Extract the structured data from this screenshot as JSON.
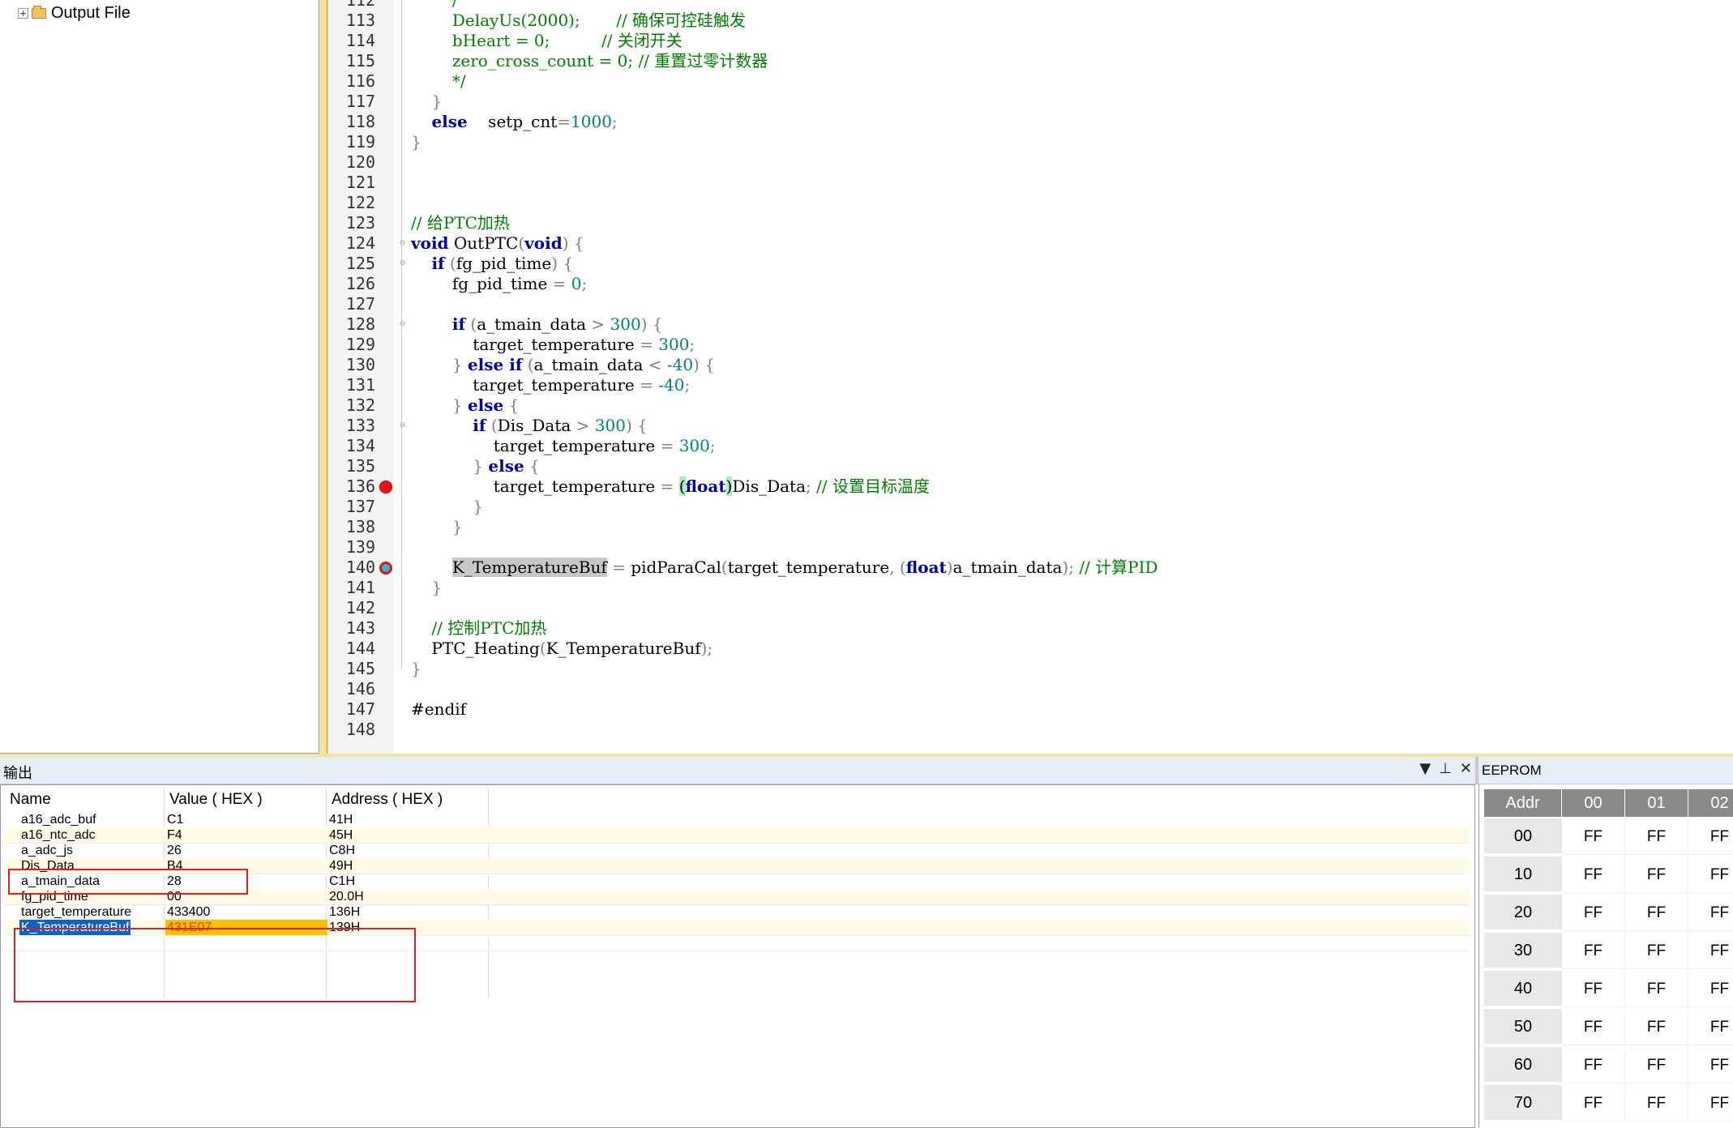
{
  "project_tree": {
    "output_file_label": "Output File"
  },
  "editor": {
    "lines": [
      {
        "n": "112",
        "html": "        <span class=\"cm\">/</span>"
      },
      {
        "n": "113",
        "html": "        <span class=\"cm\">DelayUs(2000);       // 确保可控硅触发</span>"
      },
      {
        "n": "114",
        "html": "        <span class=\"cm\">bHeart = 0;          // 关闭开关</span>"
      },
      {
        "n": "115",
        "html": "        <span class=\"cm\">zero_cross_count = 0; // 重置过零计数器</span>"
      },
      {
        "n": "116",
        "html": "        <span class=\"cm\">*/</span>"
      },
      {
        "n": "117",
        "html": "    <span class=\"pun\">}</span>"
      },
      {
        "n": "118",
        "html": "    <span class=\"kw\">else</span>    setp_cnt<span class=\"pun\">=</span><span class=\"num\">1000</span><span class=\"pun\">;</span>"
      },
      {
        "n": "119",
        "html": "<span class=\"pun\">}</span>"
      },
      {
        "n": "120",
        "html": ""
      },
      {
        "n": "121",
        "html": ""
      },
      {
        "n": "122",
        "html": ""
      },
      {
        "n": "123",
        "html": "<span class=\"cm\">// 给PTC加热</span>"
      },
      {
        "n": "124",
        "html": "<span class=\"kw\">void</span> OutPTC<span class=\"pun\">(</span><span class=\"kw\">void</span><span class=\"pun\">)</span> <span class=\"pun\">{</span>"
      },
      {
        "n": "125",
        "html": "    <span class=\"kw\">if</span> <span class=\"pun\">(</span>fg_pid_time<span class=\"pun\">)</span> <span class=\"pun\">{</span>"
      },
      {
        "n": "126",
        "html": "        fg_pid_time <span class=\"pun\">=</span> <span class=\"num\">0</span><span class=\"pun\">;</span>"
      },
      {
        "n": "127",
        "html": ""
      },
      {
        "n": "128",
        "html": "        <span class=\"kw\">if</span> <span class=\"pun\">(</span>a_tmain_data <span class=\"pun\">&gt;</span> <span class=\"num\">300</span><span class=\"pun\">)</span> <span class=\"pun\">{</span>"
      },
      {
        "n": "129",
        "html": "            target_temperature <span class=\"pun\">=</span> <span class=\"num\">300</span><span class=\"pun\">;</span>"
      },
      {
        "n": "130",
        "html": "        <span class=\"pun\">}</span> <span class=\"kw\">else if</span> <span class=\"pun\">(</span>a_tmain_data <span class=\"pun\">&lt;</span> <span class=\"num\">-40</span><span class=\"pun\">)</span> <span class=\"pun\">{</span>"
      },
      {
        "n": "131",
        "html": "            target_temperature <span class=\"pun\">=</span> <span class=\"num\">-40</span><span class=\"pun\">;</span>"
      },
      {
        "n": "132",
        "html": "        <span class=\"pun\">}</span> <span class=\"kw\">else</span> <span class=\"pun\">{</span>"
      },
      {
        "n": "133",
        "html": "            <span class=\"kw\">if</span> <span class=\"pun\">(</span>Dis_Data <span class=\"pun\">&gt;</span> <span class=\"num\">300</span><span class=\"pun\">)</span> <span class=\"pun\">{</span>"
      },
      {
        "n": "134",
        "html": "                target_temperature <span class=\"pun\">=</span> <span class=\"num\">300</span><span class=\"pun\">;</span>"
      },
      {
        "n": "135",
        "html": "            <span class=\"pun\">}</span> <span class=\"kw\">else</span> <span class=\"pun\">{</span>"
      },
      {
        "n": "136",
        "html": "                target_temperature <span class=\"pun\">=</span> <span class=\"br\">(</span><span class=\"kw\">float</span><span class=\"br\">)</span>Dis_Data<span class=\"pun\">;</span> <span class=\"cm\">// 设置目标温度</span>"
      },
      {
        "n": "137",
        "html": "            <span class=\"pun\">}</span>"
      },
      {
        "n": "138",
        "html": "        <span class=\"pun\">}</span>"
      },
      {
        "n": "139",
        "html": ""
      },
      {
        "n": "140",
        "html": "        <span class=\"hl\">K_TemperatureBuf</span> <span class=\"pun\">=</span> pidParaCal<span class=\"pun\">(</span>target_temperature<span class=\"pun\">,</span> <span class=\"pun\">(</span><span class=\"kw\">float</span><span class=\"pun\">)</span>a_tmain_data<span class=\"pun\">);</span> <span class=\"cm\">// 计算PID</span>"
      },
      {
        "n": "141",
        "html": "    <span class=\"pun\">}</span>"
      },
      {
        "n": "142",
        "html": ""
      },
      {
        "n": "143",
        "html": "    <span class=\"cm\">// 控制PTC加热</span>"
      },
      {
        "n": "144",
        "html": "    PTC_Heating<span class=\"pun\">(</span>K_TemperatureBuf<span class=\"pun\">);</span>"
      },
      {
        "n": "145",
        "html": "<span class=\"pun\">}</span>"
      },
      {
        "n": "146",
        "html": ""
      },
      {
        "n": "147",
        "html": "#endif"
      },
      {
        "n": "148",
        "html": ""
      }
    ]
  },
  "output_panel": {
    "title": "输出",
    "buttons": {
      "dropdown": "▼",
      "pin": "⊥",
      "close": "✕"
    },
    "headers": {
      "name": "Name",
      "value": "Value ( HEX )",
      "address": "Address ( HEX )"
    },
    "rows": [
      {
        "name": "a16_adc_buf",
        "value": "C1",
        "address": "41H"
      },
      {
        "name": "a16_ntc_adc",
        "value": "F4",
        "address": "45H"
      },
      {
        "name": "a_adc_js",
        "value": "26",
        "address": "C8H"
      },
      {
        "name": "Dis_Data",
        "value": "B4",
        "address": "49H"
      },
      {
        "name": "a_tmain_data",
        "value": "28",
        "address": "C1H"
      },
      {
        "name": "fg_pid_time",
        "value": "00",
        "address": "20.0H"
      },
      {
        "name": "target_temperature",
        "value": "433400",
        "address": "136H"
      },
      {
        "name": "K_TemperatureBuf",
        "value": "431E07",
        "address": "139H"
      }
    ]
  },
  "eeprom_panel": {
    "title": "EEPROM",
    "headers": [
      "Addr",
      "00",
      "01",
      "02"
    ],
    "rows": [
      {
        "addr": "00",
        "cells": [
          "FF",
          "FF",
          "FF"
        ]
      },
      {
        "addr": "10",
        "cells": [
          "FF",
          "FF",
          "FF"
        ]
      },
      {
        "addr": "20",
        "cells": [
          "FF",
          "FF",
          "FF"
        ]
      },
      {
        "addr": "30",
        "cells": [
          "FF",
          "FF",
          "FF"
        ]
      },
      {
        "addr": "40",
        "cells": [
          "FF",
          "FF",
          "FF"
        ]
      },
      {
        "addr": "50",
        "cells": [
          "FF",
          "FF",
          "FF"
        ]
      },
      {
        "addr": "60",
        "cells": [
          "FF",
          "FF",
          "FF"
        ]
      },
      {
        "addr": "70",
        "cells": [
          "FF",
          "FF",
          "FF"
        ]
      }
    ]
  }
}
